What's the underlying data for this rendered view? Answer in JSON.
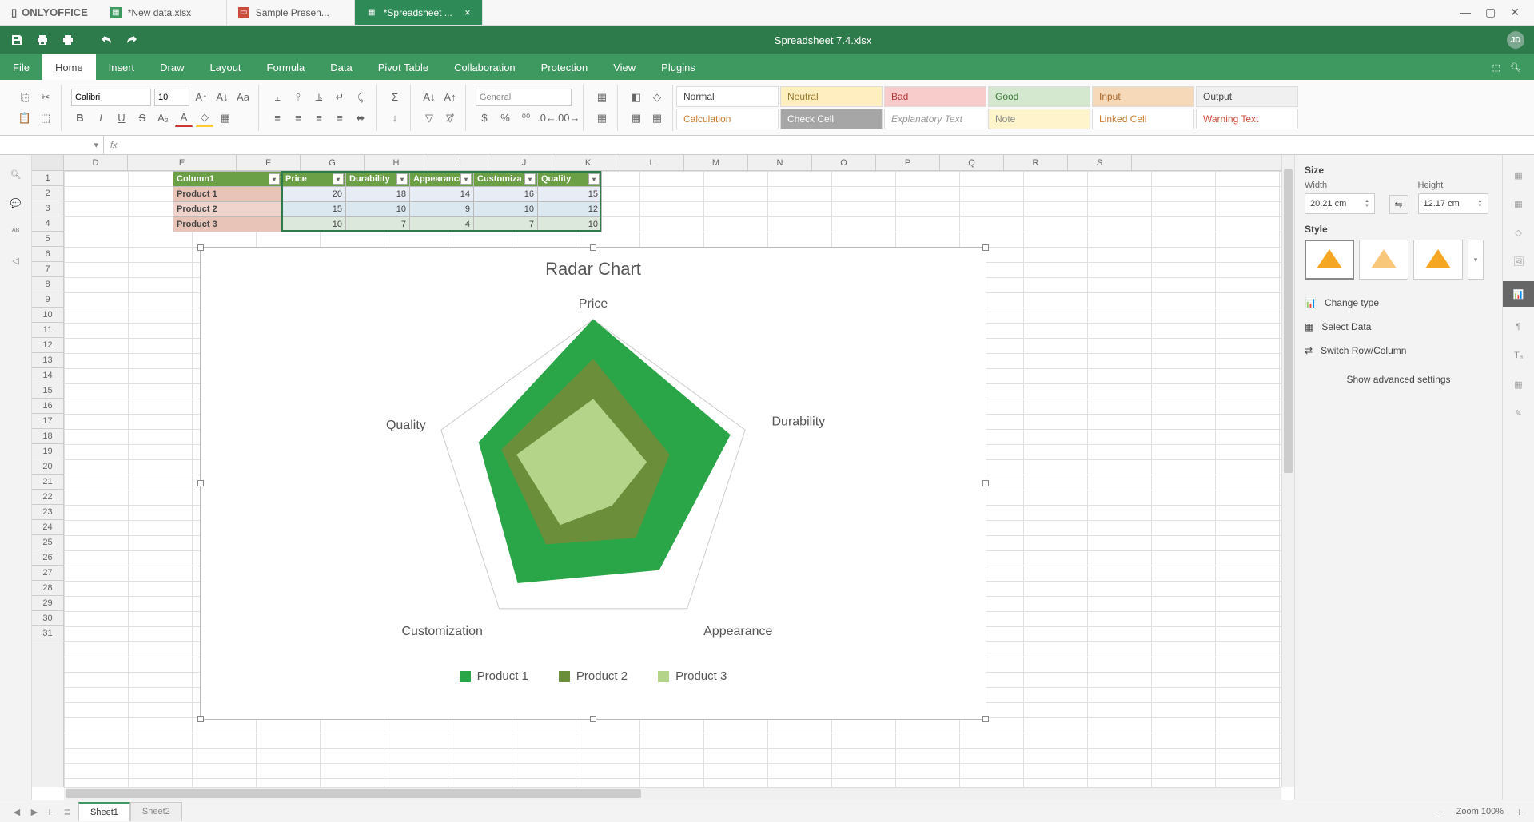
{
  "app": {
    "name": "ONLYOFFICE"
  },
  "doc_tabs": [
    {
      "label": "*New data.xlsx",
      "icon_color": "#3d9960"
    },
    {
      "label": "Sample Presen...",
      "icon_color": "#c94d3a"
    },
    {
      "label": "*Spreadsheet ...",
      "icon_color": "#fff"
    }
  ],
  "doc_title": "Spreadsheet 7.4.xlsx",
  "user_initials": "JD",
  "menus": [
    "File",
    "Home",
    "Insert",
    "Draw",
    "Layout",
    "Formula",
    "Data",
    "Pivot Table",
    "Collaboration",
    "Protection",
    "View",
    "Plugins"
  ],
  "menu_active": "Home",
  "ribbon": {
    "font_name": "Calibri",
    "font_size": "10",
    "num_format": "General",
    "styles": [
      {
        "label": "Normal",
        "bg": "#fff",
        "color": "#444"
      },
      {
        "label": "Neutral",
        "bg": "#feeec0",
        "color": "#9c7a2e"
      },
      {
        "label": "Bad",
        "bg": "#f9cccc",
        "color": "#b03a3a"
      },
      {
        "label": "Good",
        "bg": "#d4e8d0",
        "color": "#3d7a3a"
      },
      {
        "label": "Input",
        "bg": "#f6d9b8",
        "color": "#a86a2e"
      },
      {
        "label": "Output",
        "bg": "#f0f0f0",
        "color": "#444"
      },
      {
        "label": "Calculation",
        "bg": "#fff",
        "color": "#c87a2e"
      },
      {
        "label": "Check Cell",
        "bg": "#a6a6a6",
        "color": "#fff"
      },
      {
        "label": "Explanatory Text",
        "bg": "#fff",
        "color": "#999",
        "italic": true
      },
      {
        "label": "Note",
        "bg": "#fff4cc",
        "color": "#888"
      },
      {
        "label": "Linked Cell",
        "bg": "#fff",
        "color": "#c87a2e"
      },
      {
        "label": "Warning Text",
        "bg": "#fff",
        "color": "#c94d3a"
      }
    ]
  },
  "columns": [
    "D",
    "E",
    "F",
    "G",
    "H",
    "I",
    "J",
    "K",
    "L",
    "M",
    "N",
    "O",
    "P",
    "Q",
    "R",
    "S"
  ],
  "table": {
    "headers": [
      "Column1",
      "Price",
      "Durability",
      "Appearance",
      "Customization",
      "Quality"
    ],
    "rows": [
      {
        "label": "Product 1",
        "values": [
          20,
          18,
          14,
          16,
          15
        ]
      },
      {
        "label": "Product 2",
        "values": [
          15,
          10,
          9,
          10,
          12
        ]
      },
      {
        "label": "Product 3",
        "values": [
          10,
          7,
          4,
          7,
          10
        ]
      }
    ]
  },
  "chart": {
    "title": "Radar Chart",
    "axes": [
      "Price",
      "Durability",
      "Appearance",
      "Customization",
      "Quality"
    ],
    "legend": [
      {
        "label": "Product 1",
        "color": "#2aa648"
      },
      {
        "label": "Product 2",
        "color": "#6b8e3a"
      },
      {
        "label": "Product 3",
        "color": "#b4d48a"
      }
    ]
  },
  "chart_data": {
    "type": "radar",
    "title": "Radar Chart",
    "categories": [
      "Price",
      "Durability",
      "Appearance",
      "Customization",
      "Quality"
    ],
    "series": [
      {
        "name": "Product 1",
        "values": [
          20,
          18,
          14,
          16,
          15
        ],
        "color": "#2aa648"
      },
      {
        "name": "Product 2",
        "values": [
          15,
          10,
          9,
          10,
          12
        ],
        "color": "#6b8e3a"
      },
      {
        "name": "Product 3",
        "values": [
          10,
          7,
          4,
          7,
          10
        ],
        "color": "#b4d48a"
      }
    ],
    "max": 20
  },
  "right_panel": {
    "size_title": "Size",
    "width_label": "Width",
    "height_label": "Height",
    "width_value": "20.21 cm",
    "height_value": "12.17 cm",
    "style_title": "Style",
    "change_type": "Change type",
    "select_data": "Select Data",
    "switch_rc": "Switch Row/Column",
    "advanced": "Show advanced settings"
  },
  "sheets": [
    "Sheet1",
    "Sheet2"
  ],
  "sheet_active": "Sheet1",
  "zoom": "Zoom 100%"
}
